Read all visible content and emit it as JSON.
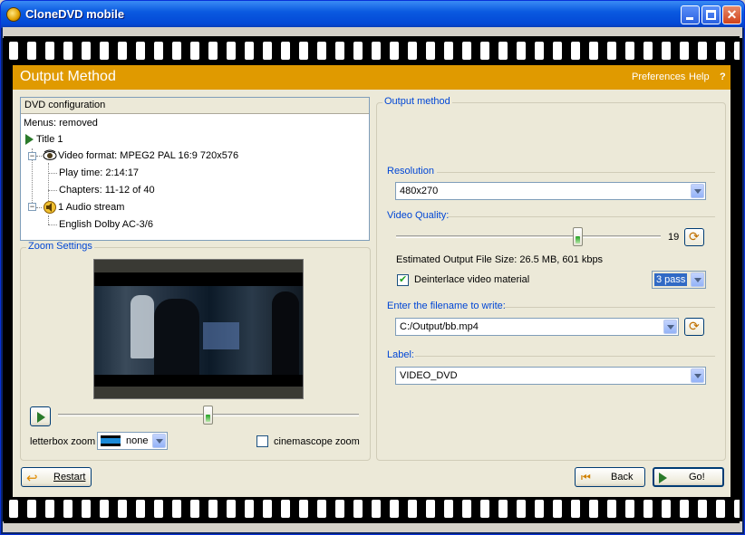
{
  "window": {
    "title": "CloneDVD mobile"
  },
  "header": {
    "title": "Output Method",
    "preferences": "Preferences",
    "help": "Help",
    "help_q": "?"
  },
  "dvd": {
    "header": "DVD configuration",
    "menus": "Menus: removed",
    "title1": "Title 1",
    "video_format": "Video format: MPEG2 PAL 16:9 720x576",
    "play_time": "Play time: 2:14:17",
    "chapters": "Chapters: 11-12 of 40",
    "audio": "1 Audio stream",
    "audio_track": "English Dolby AC-3/6"
  },
  "zoom": {
    "legend": "Zoom Settings",
    "letterbox_label": "letterbox zoom",
    "letterbox_value": "none",
    "cinemascope_label": "cinemascope zoom",
    "cinemascope_checked": false,
    "slider_position": 0.5
  },
  "output": {
    "legend": "Output method",
    "resolution_label": "Resolution",
    "resolution_value": "480x270",
    "quality_label": "Video Quality:",
    "quality_value": "19",
    "quality_fraction": 0.69,
    "estimate": "Estimated Output File Size: 26.5 MB, 601 kbps",
    "deinterlace_label": "Deinterlace video material",
    "deinterlace_checked": true,
    "pass_value": "3 pass",
    "filename_label": "Enter the filename to write:",
    "filename_value": "C:/Output/bb.mp4",
    "label_label": "Label:",
    "label_value": "VIDEO_DVD"
  },
  "footer": {
    "restart": "Restart",
    "back": "Back",
    "go": "Go!"
  }
}
